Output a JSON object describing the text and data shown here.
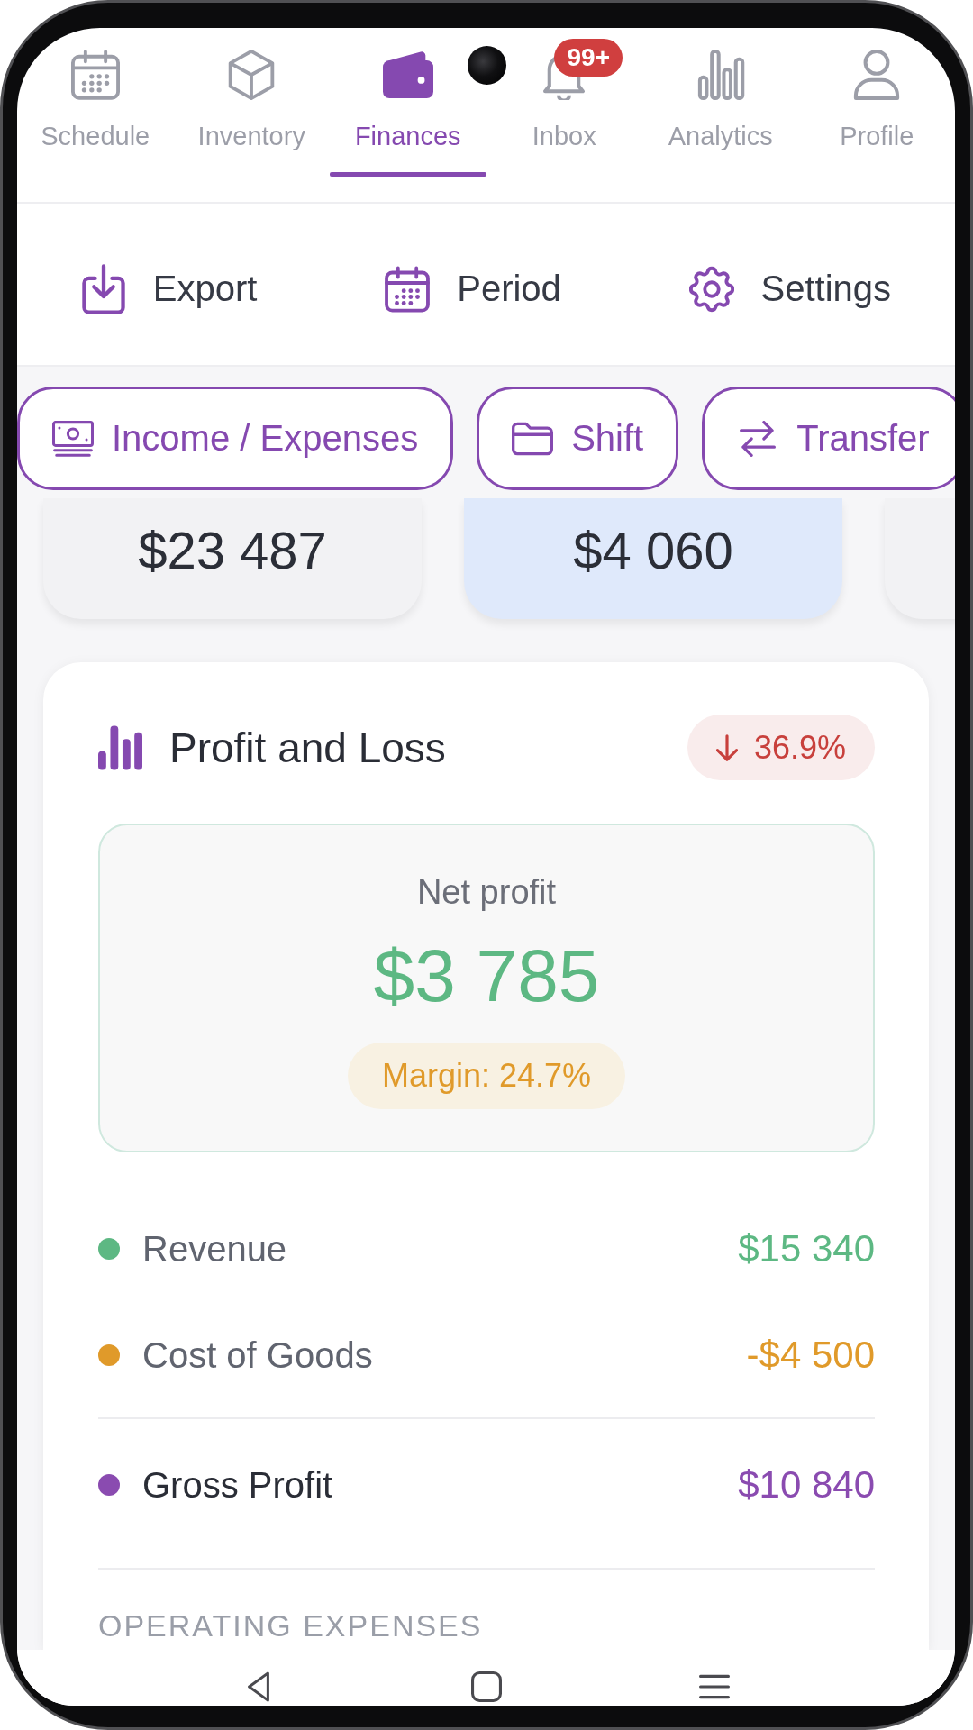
{
  "tabs": [
    {
      "label": "Schedule",
      "selected": false
    },
    {
      "label": "Inventory",
      "selected": false
    },
    {
      "label": "Finances",
      "selected": true
    },
    {
      "label": "Inbox",
      "selected": false,
      "badge": "99+"
    },
    {
      "label": "Analytics",
      "selected": false
    },
    {
      "label": "Profile",
      "selected": false
    }
  ],
  "actions": [
    {
      "label": "Export"
    },
    {
      "label": "Period"
    },
    {
      "label": "Settings"
    }
  ],
  "categories": [
    {
      "label": "Income / Expenses"
    },
    {
      "label": "Shift"
    },
    {
      "label": "Transfer"
    }
  ],
  "summary_cards": [
    {
      "value": "$23 487",
      "selected": false
    },
    {
      "value": "$4 060",
      "selected": true
    },
    {
      "selected": false
    }
  ],
  "profit_and_loss": {
    "title": "Profit and Loss",
    "change": {
      "down": true,
      "value": "36.9%"
    },
    "net_profit": {
      "label": "Net profit",
      "value": "$3 785",
      "margin": "Margin: 24.7%"
    },
    "rows": [
      {
        "kind": "item",
        "label": "Revenue",
        "value": "$15 340",
        "color": "#5db883"
      },
      {
        "kind": "item",
        "label": "Cost of Goods",
        "value": "-$4 500",
        "color": "#e09a2a"
      },
      {
        "kind": "subtotal",
        "label": "Gross Profit",
        "value": "$10 840",
        "color": "#8a4bb0"
      }
    ],
    "section_heading": "OPERATING EXPENSES"
  }
}
